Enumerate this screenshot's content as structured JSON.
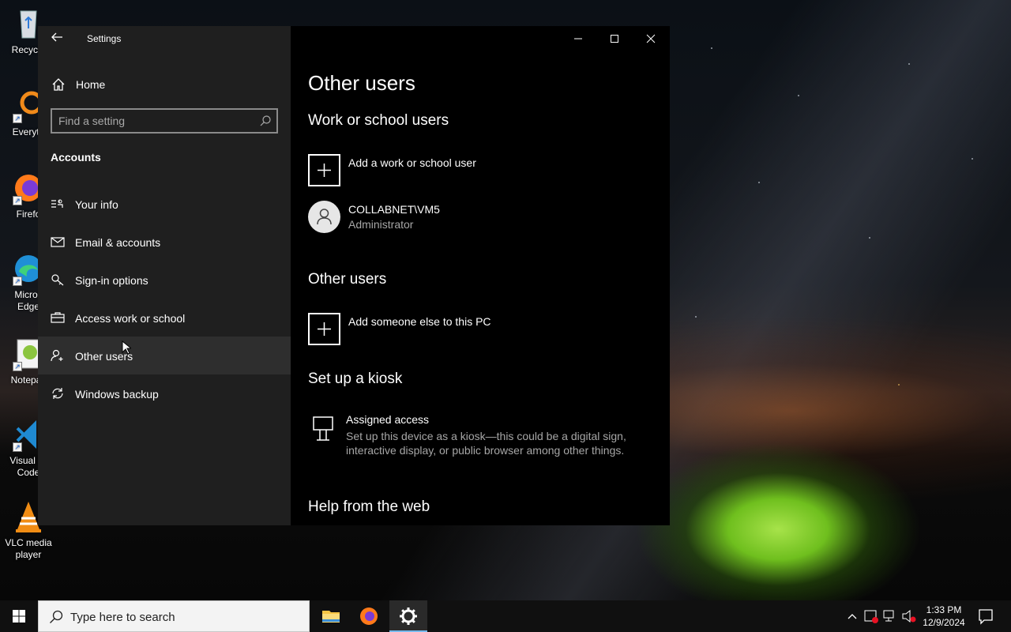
{
  "desktop": {
    "icons": [
      {
        "label": "Recycle",
        "icon": "recycle-bin-icon"
      },
      {
        "label": "Everyth",
        "icon": "everything-search-icon"
      },
      {
        "label": "Firefo",
        "icon": "firefox-icon"
      },
      {
        "label": "Micros\nEdge",
        "icon": "edge-icon"
      },
      {
        "label": "Notepac",
        "icon": "notepad-plus-plus-icon"
      },
      {
        "label": "Visual St\nCode",
        "icon": "vscode-icon"
      },
      {
        "label": "VLC media\nplayer",
        "icon": "vlc-icon"
      }
    ]
  },
  "window": {
    "title": "Settings",
    "controls": {
      "minimize": "minimize-icon",
      "maximize": "maximize-icon",
      "close": "close-icon"
    }
  },
  "sidebar": {
    "home_label": "Home",
    "search_placeholder": "Find a setting",
    "section_title": "Accounts",
    "items": [
      {
        "label": "Your info",
        "icon": "contact-card-icon",
        "active": false
      },
      {
        "label": "Email & accounts",
        "icon": "mail-icon",
        "active": false
      },
      {
        "label": "Sign-in options",
        "icon": "key-icon",
        "active": false
      },
      {
        "label": "Access work or school",
        "icon": "briefcase-icon",
        "active": false
      },
      {
        "label": "Other users",
        "icon": "add-person-icon",
        "active": true
      },
      {
        "label": "Windows backup",
        "icon": "sync-icon",
        "active": false
      }
    ]
  },
  "main": {
    "title": "Other users",
    "work_school": {
      "heading": "Work or school users",
      "add_label": "Add a work or school user",
      "user": {
        "name": "COLLABNET\\VM5",
        "role": "Administrator"
      }
    },
    "other_users": {
      "heading": "Other users",
      "add_label": "Add someone else to this PC"
    },
    "kiosk": {
      "heading": "Set up a kiosk",
      "name": "Assigned access",
      "description": "Set up this device as a kiosk—this could be a digital sign, interactive display, or public browser among other things."
    },
    "help_heading": "Help from the web"
  },
  "taskbar": {
    "search_placeholder": "Type here to search",
    "apps": [
      "file-explorer-icon",
      "firefox-icon",
      "settings-gear-icon"
    ],
    "time": "1:33 PM",
    "date": "12/9/2024"
  },
  "colors": {
    "accent": "#76b9ed",
    "sidebar_bg": "#1f1f1f",
    "content_bg": "#000000"
  }
}
